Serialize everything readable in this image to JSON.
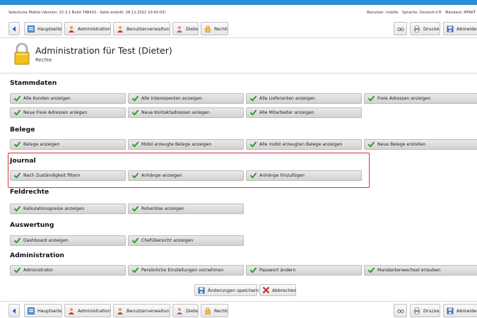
{
  "info": {
    "version_line": "SelectLine Mobile (Version: 22.3.1 Build 748410 - Seite erstellt: 28.12.2022 10:43:03)",
    "user": "Benutzer: mobile",
    "language": "Sprache: Deutsch-CH",
    "client": "Mandant: MFAKT"
  },
  "toolbar": {
    "home": "Hauptseite",
    "administration": "Administration",
    "user_management": "Benutzerverwaltung",
    "user": "Dieter",
    "rights": "Rechte",
    "print": "Drucken",
    "logout": "Abmelder"
  },
  "header": {
    "title": "Administration für Test (Dieter)",
    "subtitle": "Rechte"
  },
  "sections": {
    "stammdaten": {
      "title": "Stammdaten",
      "items": [
        "Alle Kunden anzeigen",
        "Alle Interessenten anzeigen",
        "Alle Lieferanten anzeigen",
        "Freie Adressen anzeigen",
        "Neue Freie Adressen anlegen",
        "Neue Kontaktadressen anlegen",
        "Alle Mitarbeiter anzeigen"
      ]
    },
    "belege": {
      "title": "Belege",
      "items": [
        "Belege anzeigen",
        "Mobil erzeugte Belege anzeigen",
        "Alle mobil erzeugten Belege anzeigen",
        "Neue Belege erstellen"
      ]
    },
    "journal": {
      "title": "Journal",
      "items": [
        "Nach Zuständigkeit filtern",
        "Anhänge anzeigen",
        "Anhänge hinzufügen"
      ]
    },
    "feldrechte": {
      "title": "Feldrechte",
      "items": [
        "Kalkulationspreise anzeigen",
        "Roherlöse anzeigen"
      ]
    },
    "auswertung": {
      "title": "Auswertung",
      "items": [
        "Dashboard anzeigen",
        "Chefübersicht anzeigen"
      ]
    },
    "administration": {
      "title": "Administration",
      "items": [
        "Administrator",
        "Persönliche Einstellungen vornehmen",
        "Passwort ändern",
        "Mandantenwechsel erlauben"
      ]
    }
  },
  "actions": {
    "save": "Änderungen speichern",
    "cancel": "Abbrechen"
  },
  "colors": {
    "accent": "#2a8fd6",
    "check": "#2e9b2e",
    "highlight": "#d6303a"
  }
}
